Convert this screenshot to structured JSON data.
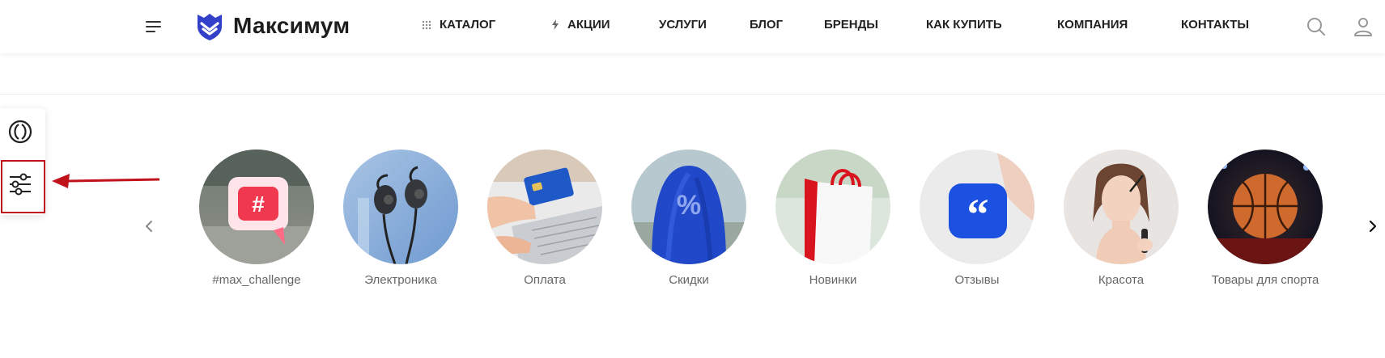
{
  "header": {
    "brand": "Максимум",
    "nav": [
      {
        "label": "КАТАЛОГ",
        "icon": "grid-dots-icon"
      },
      {
        "label": "АКЦИИ",
        "icon": "lightning-icon"
      },
      {
        "label": "УСЛУГИ"
      },
      {
        "label": "БЛОГ"
      },
      {
        "label": "БРЕНДЫ"
      },
      {
        "label": "КАК КУПИТЬ"
      },
      {
        "label": "КОМПАНИЯ"
      },
      {
        "label": "КОНТАКТЫ"
      }
    ],
    "icons": [
      "menu-icon",
      "search-icon",
      "user-icon"
    ],
    "brand_color": "#3340c9"
  },
  "side_panel": {
    "icons": [
      "circles-icon",
      "filter-sliders-icon"
    ],
    "highlight_color": "#c0121b"
  },
  "stories": {
    "items": [
      {
        "label": "#max_challenge",
        "icon": "hashtag-bubble-icon"
      },
      {
        "label": "Электроника",
        "icon": "earphones-icon"
      },
      {
        "label": "Оплата",
        "icon": "credit-card-icon"
      },
      {
        "label": "Скидки",
        "icon": "discount-percent-icon"
      },
      {
        "label": "Новинки",
        "icon": "shopping-bag-icon"
      },
      {
        "label": "Отзывы",
        "icon": "quote-icon"
      },
      {
        "label": "Красота",
        "icon": "beauty-icon"
      },
      {
        "label": "Товары для спорта",
        "icon": "basketball-icon"
      }
    ],
    "arrows": [
      "chevron-left-icon",
      "chevron-right-icon"
    ]
  }
}
